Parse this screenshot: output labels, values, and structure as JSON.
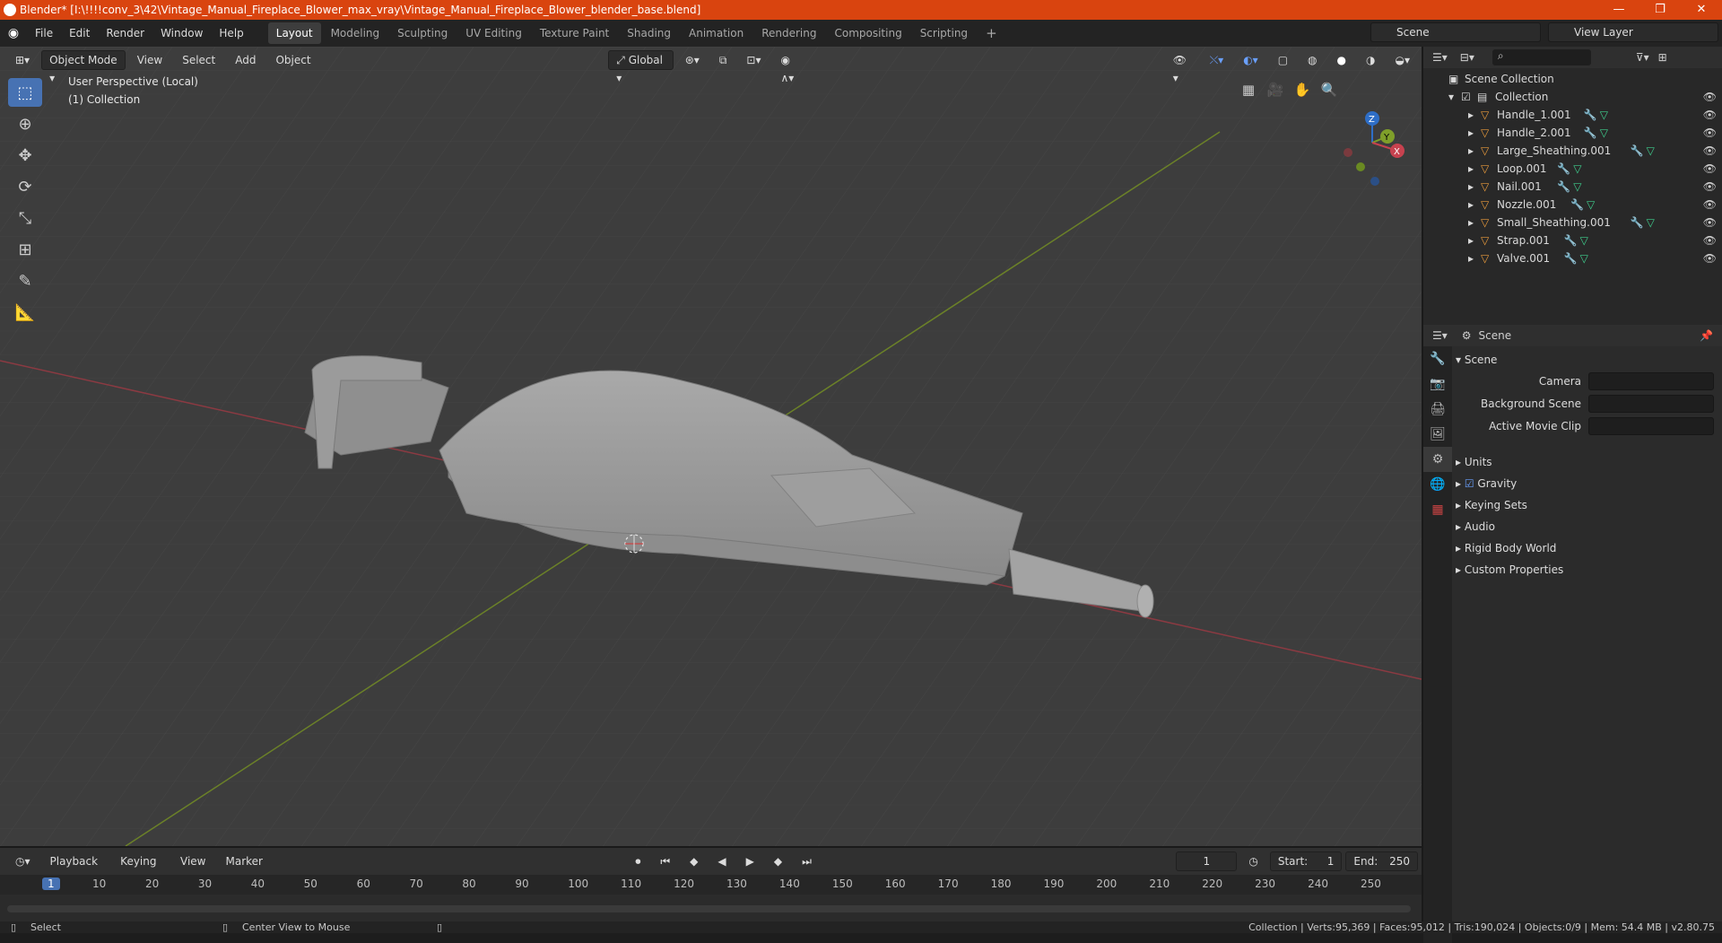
{
  "title_bar": {
    "title": "Blender* [I:\\!!!!conv_3\\42\\Vintage_Manual_Fireplace_Blower_max_vray\\Vintage_Manual_Fireplace_Blower_blender_base.blend]",
    "minimize": "—",
    "restore": "❐",
    "close": "✕"
  },
  "menu": [
    "File",
    "Edit",
    "Render",
    "Window",
    "Help"
  ],
  "workspaces": [
    "Layout",
    "Modeling",
    "Sculpting",
    "UV Editing",
    "Texture Paint",
    "Shading",
    "Animation",
    "Rendering",
    "Compositing",
    "Scripting"
  ],
  "scene_selector": "Scene",
  "view_layer_selector": "View Layer",
  "viewport_header": {
    "mode": "Object Mode",
    "menus": [
      "View",
      "Select",
      "Add",
      "Object"
    ],
    "transform_orientation": "Global"
  },
  "viewport": {
    "perspective": "User Perspective (Local)",
    "collection": "(1) Collection",
    "gizmo_axes": [
      "Z",
      "Y",
      "X"
    ]
  },
  "outliner": {
    "root": "Scene Collection",
    "collection": "Collection",
    "objects": [
      "Handle_1.001",
      "Handle_2.001",
      "Large_Sheathing.001",
      "Loop.001",
      "Nail.001",
      "Nozzle.001",
      "Small_Sheathing.001",
      "Strap.001",
      "Valve.001"
    ]
  },
  "properties": {
    "context": "Scene",
    "panel": "Scene",
    "fields": [
      {
        "label": "Camera"
      },
      {
        "label": "Background Scene"
      },
      {
        "label": "Active Movie Clip"
      }
    ],
    "sections": [
      "Units",
      "Gravity",
      "Keying Sets",
      "Audio",
      "Rigid Body World",
      "Custom Properties"
    ],
    "gravity_checked": true
  },
  "timeline": {
    "menus": [
      "Playback",
      "Keying",
      "View",
      "Marker"
    ],
    "current_frame": "1",
    "start_label": "Start:",
    "start": "1",
    "end_label": "End:",
    "end": "250",
    "ticks": [
      "1",
      "10",
      "20",
      "30",
      "40",
      "50",
      "60",
      "70",
      "80",
      "90",
      "100",
      "110",
      "120",
      "130",
      "140",
      "150",
      "160",
      "170",
      "180",
      "190",
      "200",
      "210",
      "220",
      "230",
      "240",
      "250"
    ]
  },
  "status_bar": {
    "left_action": "Select",
    "mid_action": "Center View to Mouse",
    "stats": "Collection | Verts:95,369 | Faces:95,012 | Tris:190,024 | Objects:0/9 | Mem: 54.4 MB | v2.80.75"
  },
  "colors": {
    "title_bar": "#d9440f",
    "accent": "#4772b3",
    "x_axis": "#c7424f",
    "y_axis": "#7f9f2a",
    "z_axis": "#2e6ec7"
  }
}
